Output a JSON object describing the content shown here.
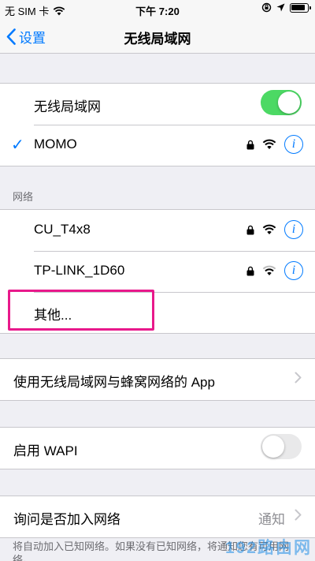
{
  "status_bar": {
    "carrier": "无 SIM 卡",
    "time": "下午 7:20"
  },
  "nav": {
    "back_label": "设置",
    "title": "无线局域网"
  },
  "wifi_toggle": {
    "label": "无线局域网",
    "on": true
  },
  "connected": {
    "name": "MOMO"
  },
  "networks_header": "网络",
  "networks": [
    {
      "name": "CU_T4x8"
    },
    {
      "name": "TP-LINK_1D60"
    }
  ],
  "other_label": "其他...",
  "app_row": {
    "label": "使用无线局域网与蜂窝网络的 App"
  },
  "wapi": {
    "label": "启用 WAPI",
    "on": false
  },
  "ask_join": {
    "label": "询问是否加入网络",
    "value": "通知"
  },
  "footer_text": "将自动加入已知网络。如果没有已知网络，将通知您有可用网络。",
  "watermark": "192路由网",
  "colors": {
    "accent": "#007aff",
    "toggle_on": "#4cd964",
    "highlight": "#e8198b"
  }
}
